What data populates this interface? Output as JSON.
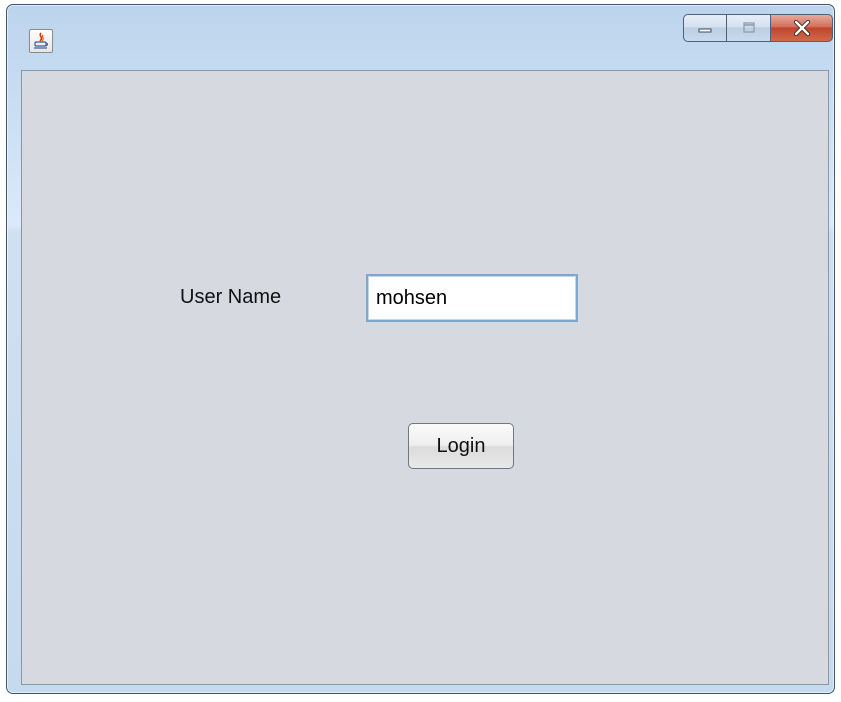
{
  "window": {
    "title": "",
    "app_icon": "java-cup-icon",
    "controls": {
      "minimize_icon": "minimize-icon",
      "maximize_icon": "maximize-icon",
      "close_icon": "close-icon"
    },
    "colors": {
      "frame": "#c6daee",
      "content_bg": "#d6d9df",
      "close_button": "#c0452d"
    }
  },
  "form": {
    "username_label": "User Name",
    "username_value": "mohsen",
    "login_label": "Login"
  }
}
